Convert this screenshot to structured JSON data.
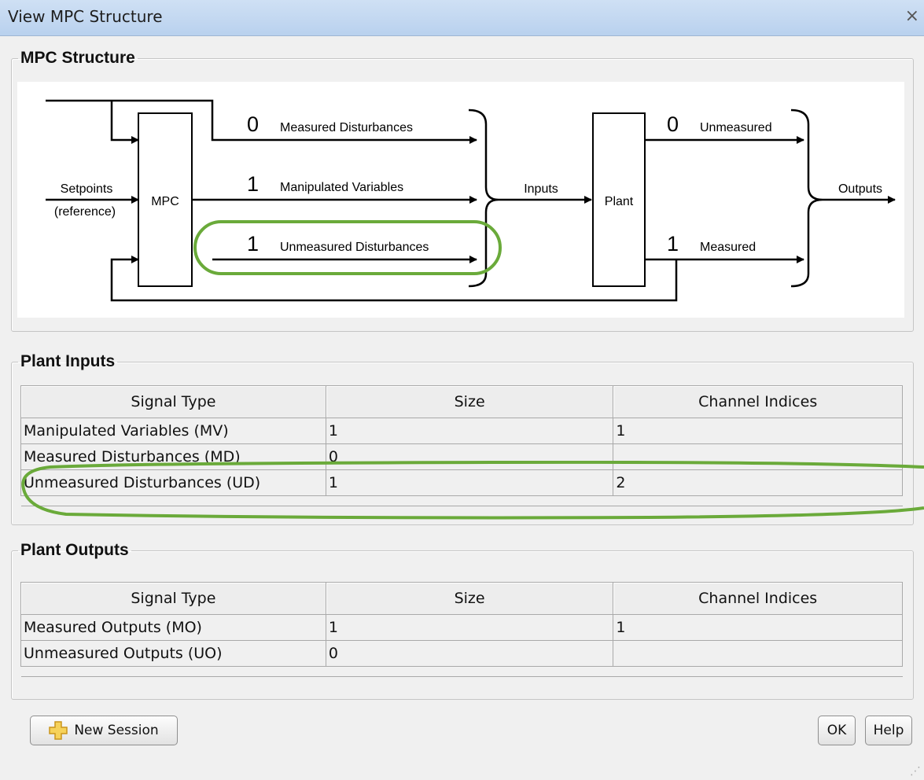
{
  "window": {
    "title": "View MPC Structure",
    "close_glyph": "×"
  },
  "structure": {
    "legend": "MPC Structure",
    "setpoints_label": "Setpoints",
    "reference_label": "(reference)",
    "mpc_label": "MPC",
    "plant_label": "Plant",
    "inputs_label": "Inputs",
    "outputs_label": "Outputs",
    "md_count": "0",
    "md_label": "Measured Disturbances",
    "mv_count": "1",
    "mv_label": "Manipulated Variables",
    "ud_count": "1",
    "ud_label": "Unmeasured Disturbances",
    "unmeasured_out_count": "0",
    "unmeasured_out_label": "Unmeasured",
    "measured_out_count": "1",
    "measured_out_label": "Measured",
    "highlight_color": "#6aaa3a"
  },
  "plant_inputs": {
    "legend": "Plant Inputs",
    "columns": [
      "Signal Type",
      "Size",
      "Channel Indices"
    ],
    "rows": [
      [
        "Manipulated Variables (MV)",
        "1",
        "1"
      ],
      [
        "Measured Disturbances (MD)",
        "0",
        ""
      ],
      [
        "Unmeasured Disturbances (UD)",
        "1",
        "2"
      ]
    ]
  },
  "plant_outputs": {
    "legend": "Plant Outputs",
    "columns": [
      "Signal Type",
      "Size",
      "Channel Indices"
    ],
    "rows": [
      [
        "Measured Outputs (MO)",
        "1",
        "1"
      ],
      [
        "Unmeasured Outputs (UO)",
        "0",
        ""
      ]
    ]
  },
  "buttons": {
    "new_session": "New Session",
    "ok": "OK",
    "help": "Help"
  },
  "icons": {
    "new_session": "plus-icon",
    "resize": "resize-grip-icon",
    "close": "close-icon"
  }
}
